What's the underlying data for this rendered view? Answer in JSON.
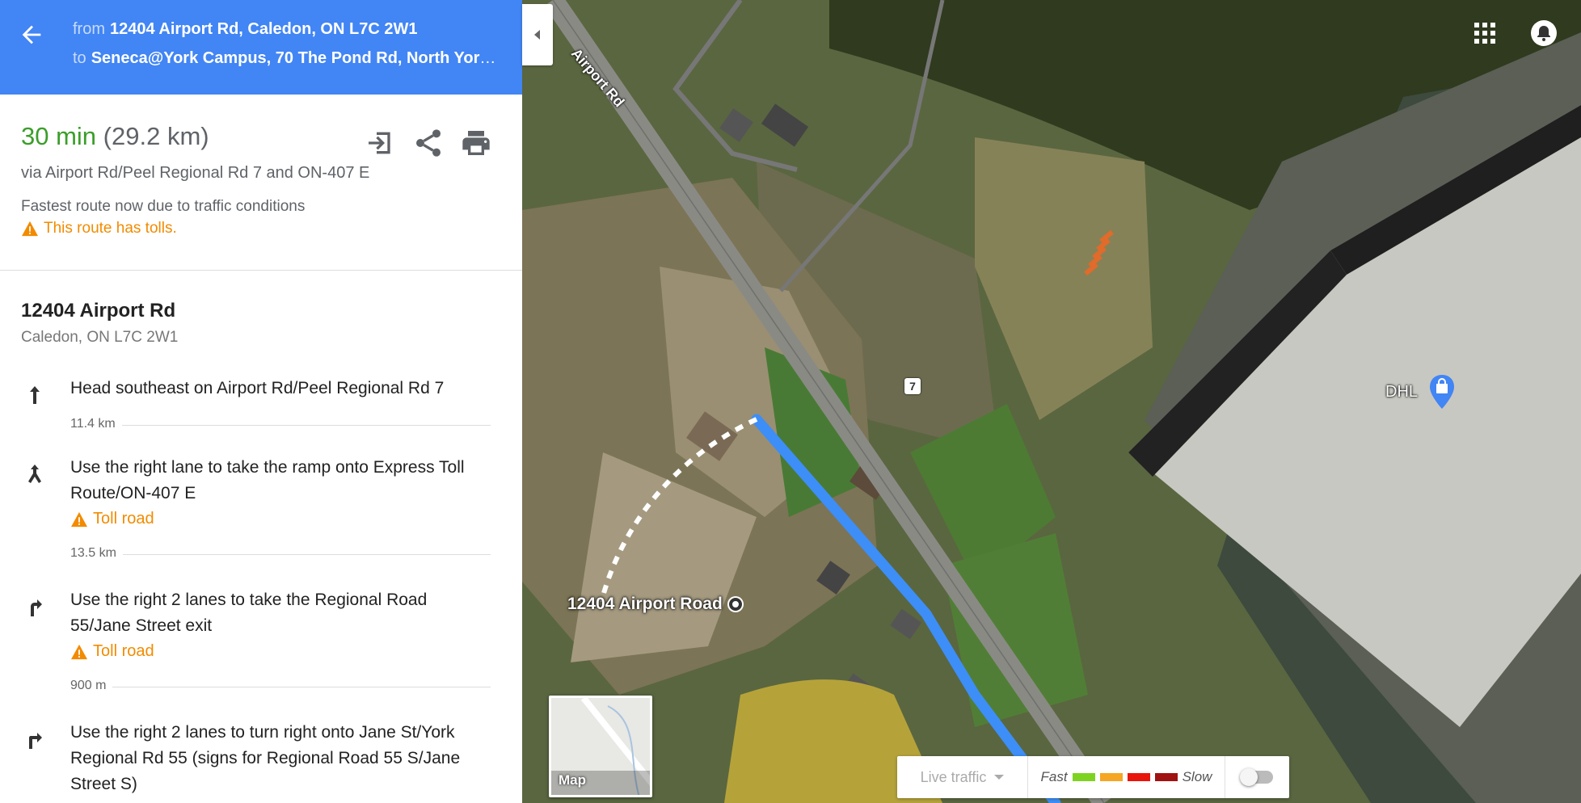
{
  "header": {
    "from_label": "from",
    "from_value": "12404 Airport Rd, Caledon, ON L7C 2W1",
    "to_label": "to",
    "to_value": "Seneca@York Campus, 70 The Pond Rd, North York..."
  },
  "summary": {
    "time": "30 min",
    "distance": "(29.2 km)",
    "via": "via Airport Rd/Peel Regional Rd 7 and ON-407 E",
    "reason": "Fastest route now due to traffic conditions",
    "toll_warning": "This route has tolls.",
    "icons": [
      "send-to-device-icon",
      "share-icon",
      "print-icon"
    ]
  },
  "origin": {
    "name": "12404 Airport Rd",
    "address": "Caledon, ON L7C 2W1"
  },
  "steps": [
    {
      "icon": "straight-arrow-icon",
      "instruction": "Head southeast on Airport Rd/Peel Regional Rd 7",
      "toll": "",
      "distance": "11.4 km"
    },
    {
      "icon": "ramp-right-icon",
      "instruction": "Use the right lane to take the ramp onto Express Toll Route/ON-407 E",
      "toll": "Toll road",
      "distance": "13.5 km"
    },
    {
      "icon": "slight-right-icon",
      "instruction": "Use the right 2 lanes to take the Regional Road 55/Jane Street exit",
      "toll": "Toll road",
      "distance": "900 m"
    },
    {
      "icon": "turn-right-icon",
      "instruction": "Use the right 2 lanes to turn right onto Jane St/York Regional Rd 55 (signs for Regional Road 55 S/Jane Street S)",
      "toll": "",
      "distance": ""
    }
  ],
  "map": {
    "road_label": "Airport Rd",
    "shield": "7",
    "poi_label": "DHL",
    "origin_label": "12404 Airport Road",
    "thumb_label": "Map",
    "route_color": "#3d8ef7"
  },
  "traffic": {
    "live_label": "Live traffic",
    "fast_label": "Fast",
    "slow_label": "Slow",
    "colors": [
      "#7ed321",
      "#f5a623",
      "#e8150c",
      "#a01212"
    ],
    "toggle_on": false
  },
  "colors": {
    "header_bg": "#4285f4",
    "time": "#3b9e2a",
    "warning": "#f28b00"
  }
}
